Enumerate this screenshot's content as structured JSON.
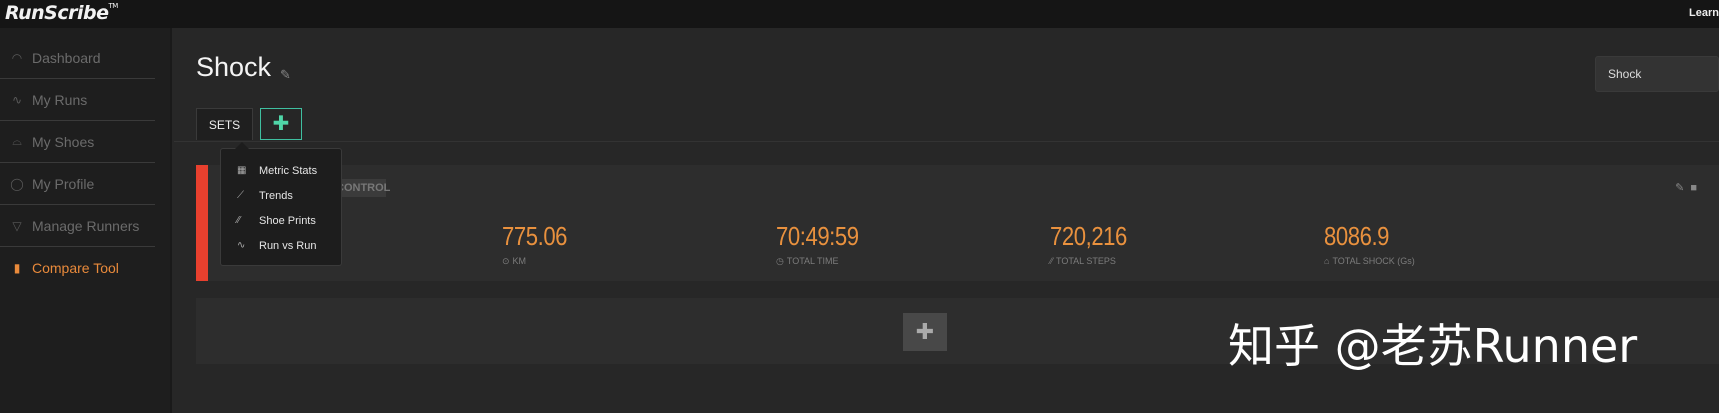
{
  "brand": {
    "logo": "RunScribe",
    "trademark": "TM"
  },
  "header": {
    "right_link": "Learn"
  },
  "sidebar": {
    "items": [
      {
        "label": "Dashboard",
        "icon": "gauge-icon"
      },
      {
        "label": "My Runs",
        "icon": "line-chart-icon"
      },
      {
        "label": "My Shoes",
        "icon": "shoe-icon"
      },
      {
        "label": "My Profile",
        "icon": "user-icon"
      },
      {
        "label": "Manage Runners",
        "icon": "shirt-icon"
      },
      {
        "label": "Compare Tool",
        "icon": "bar-chart-icon",
        "active": true
      }
    ]
  },
  "page": {
    "title": "Shock",
    "selector_value": "Shock",
    "tabs": [
      {
        "label": "SETS"
      }
    ],
    "add_tab_label": "✚"
  },
  "set_card": {
    "tag": "CONTROL",
    "stats": [
      {
        "value": "775.06",
        "label": "KM",
        "icon": "pin-icon"
      },
      {
        "value": "70:49:59",
        "label": "TOTAL TIME",
        "icon": "clock-icon"
      },
      {
        "value": "720,216",
        "label": "TOTAL STEPS",
        "icon": "footprints-icon"
      },
      {
        "value": "8086.9",
        "label": "TOTAL SHOCK (Gs)",
        "icon": "shock-icon"
      }
    ]
  },
  "add_panel": {
    "label": "✚"
  },
  "dropdown": {
    "items": [
      {
        "label": "Metric Stats",
        "icon": "table-icon"
      },
      {
        "label": "Trends",
        "icon": "trend-icon"
      },
      {
        "label": "Shoe Prints",
        "icon": "footprints-icon"
      },
      {
        "label": "Run vs Run",
        "icon": "line-chart-icon"
      }
    ]
  },
  "watermark": "知乎 @老苏Runner",
  "colors": {
    "accent": "#e9913e",
    "active_nav": "#e98a3b",
    "set_bar": "#e8402e",
    "add_tab": "#4fd6a8"
  }
}
